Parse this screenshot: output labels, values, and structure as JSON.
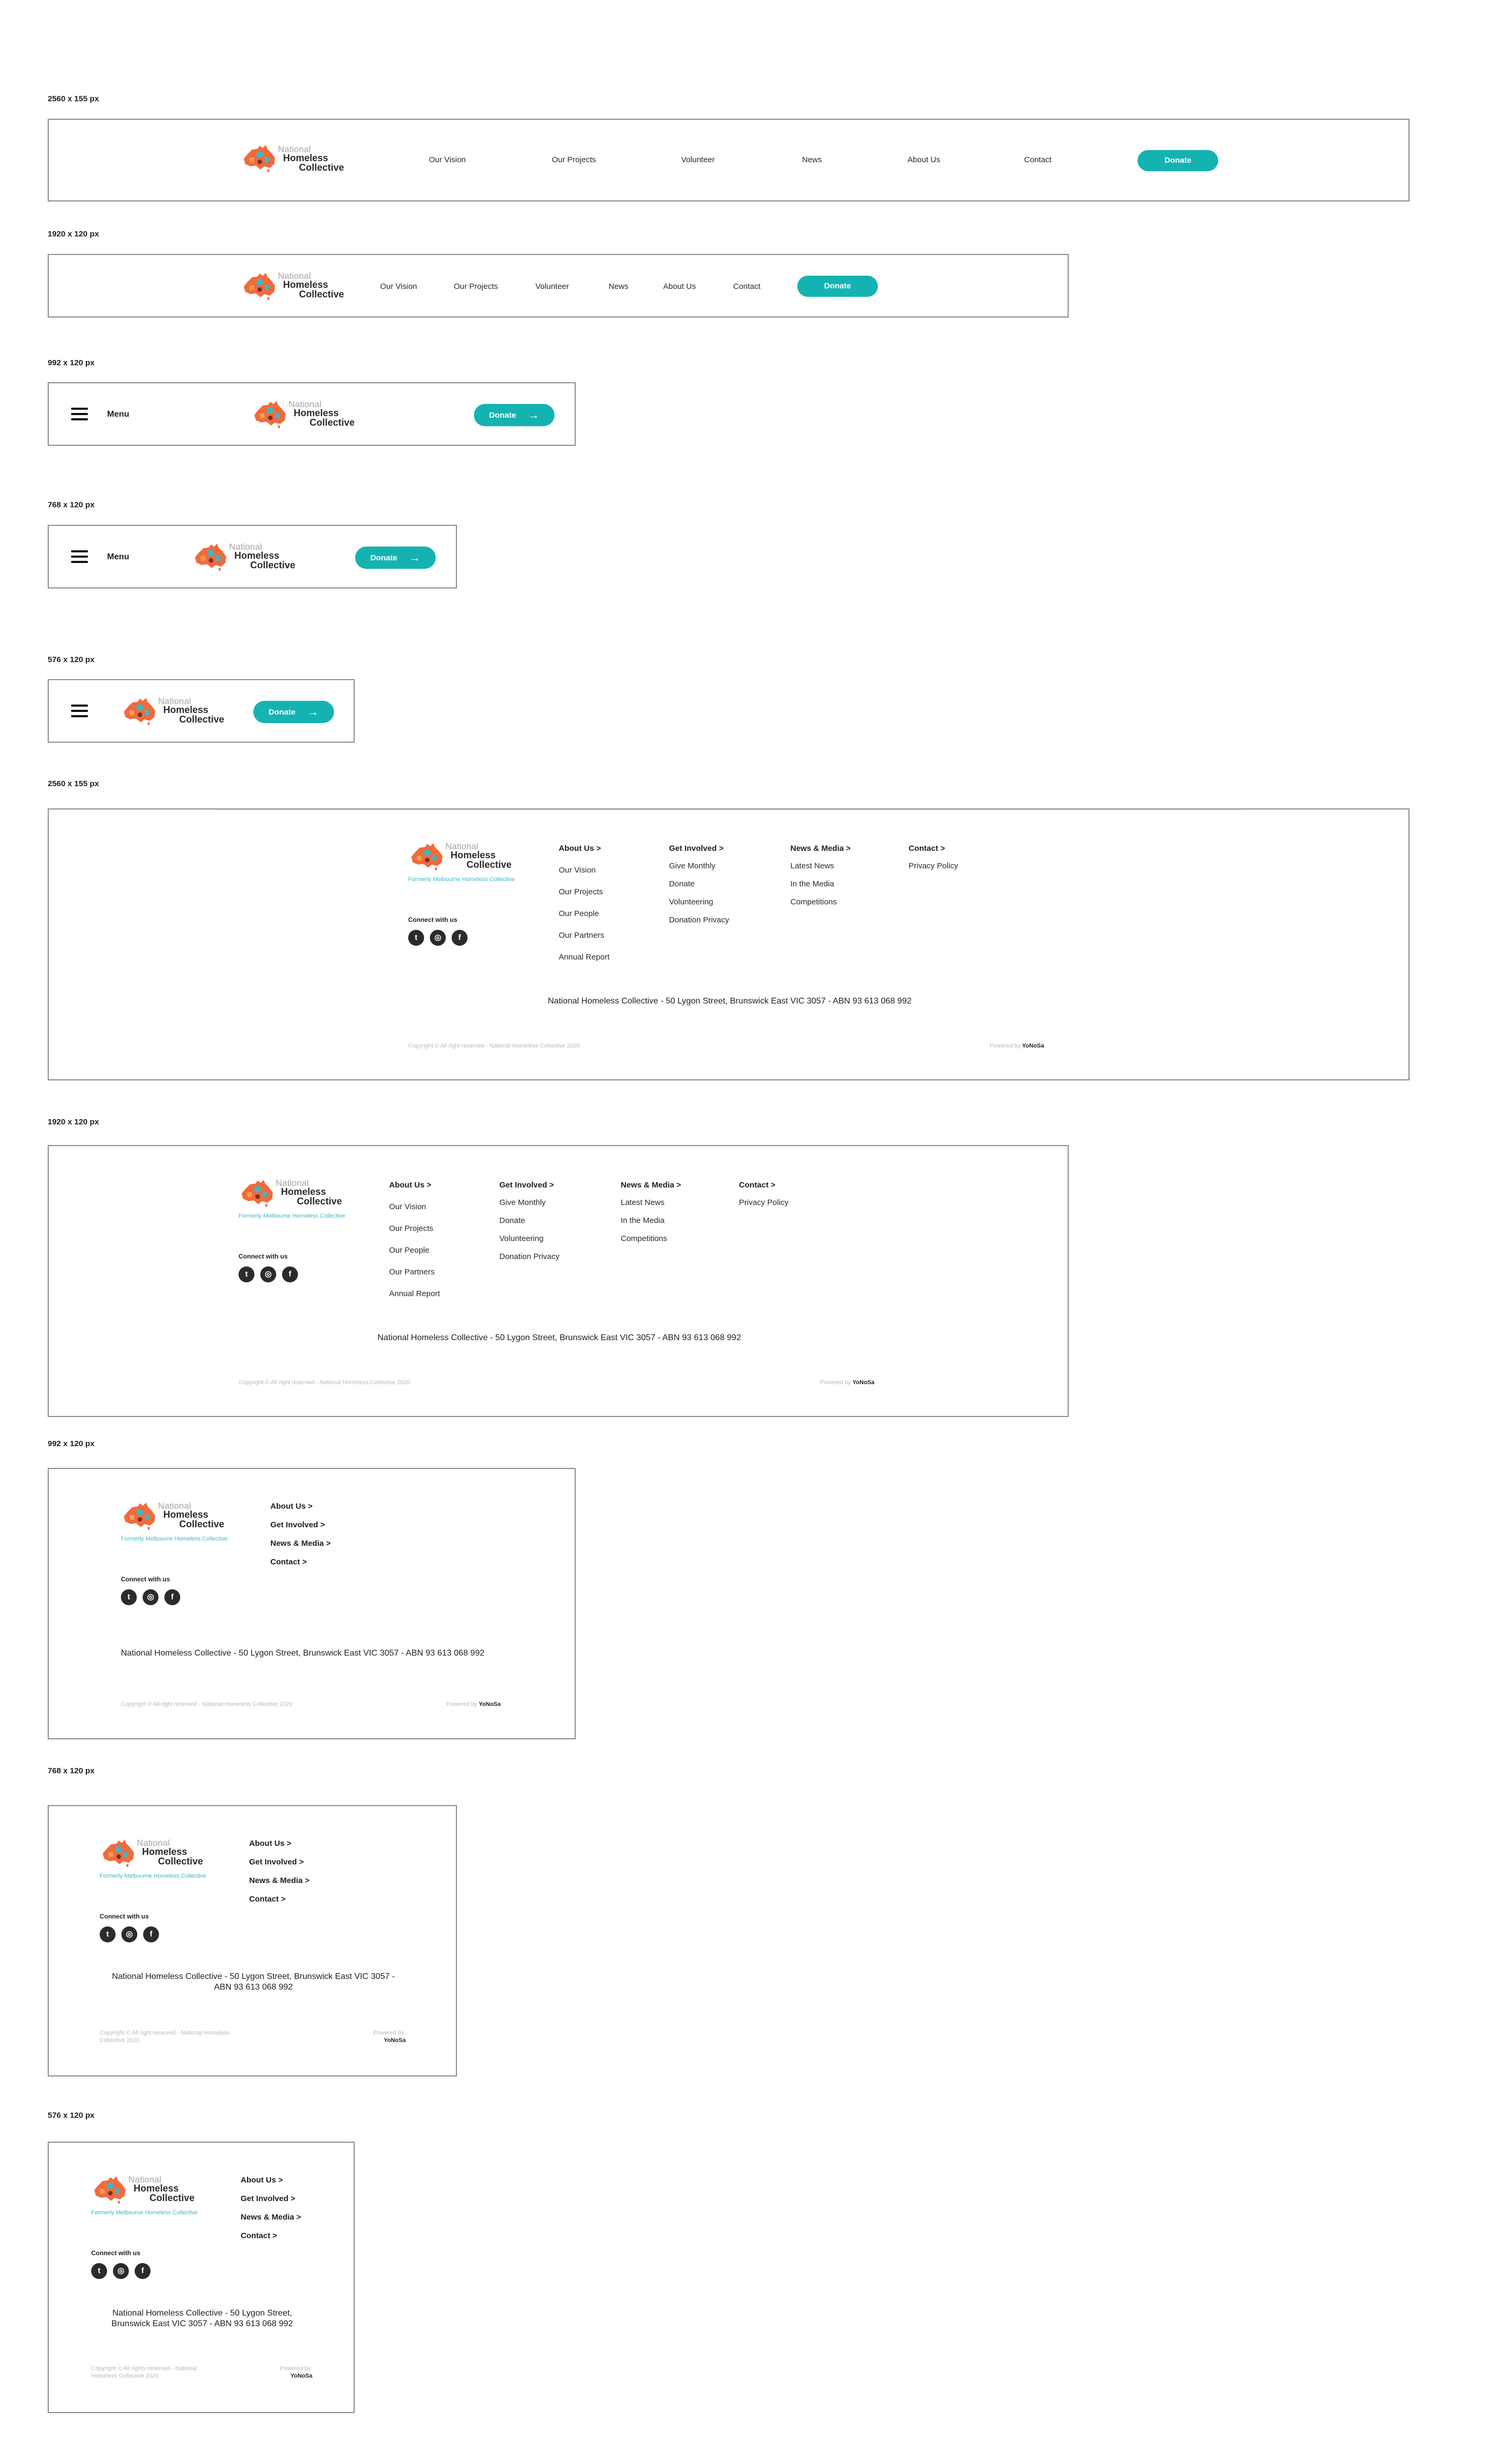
{
  "labels": {
    "h2560": "2560 x 155 px",
    "h1920": "1920 x 120 px",
    "h992": "992 x 120 px",
    "h768": "768 x 120 px",
    "h576": "576 x 120 px",
    "f2560": "2560 x 155 px",
    "f1920": "1920 x 120 px",
    "f992": "992 x 120 px",
    "f768": "768 x 120 px",
    "f576": "576 x 120 px"
  },
  "brand": {
    "line1": "National",
    "line2": "Homeless",
    "line3": "Collective",
    "tagline": "Formerly Melbourne Homeless Collective"
  },
  "nav": {
    "vision": "Our Vision",
    "projects": "Our Projects",
    "volunteer": "Volunteer",
    "news": "News",
    "about": "About Us",
    "contact": "Contact",
    "donate": "Donate",
    "menu": "Menu",
    "arrow": "→"
  },
  "footer": {
    "about_head": "About Us >",
    "about_links": [
      "Our Vision",
      "Our Projects",
      "Our People",
      "Our Partners",
      "Annual Report"
    ],
    "involved_head": "Get Involved >",
    "involved_links": [
      "Give Monthly",
      "Donate",
      "Volunteering",
      "Donation Privacy"
    ],
    "news_head": "News & Media >",
    "news_links": [
      "Latest News",
      "In the Media",
      "Competitions"
    ],
    "contact_head": "Contact >",
    "contact_links": [
      "Privacy Policy"
    ],
    "connect": "Connect with us",
    "address": "National Homeless Collective - 50 Lygon Street, Brunswick East VIC 3057 - ABN 93 613 068 992",
    "address_768_a": "National Homeless Collective - 50 Lygon Street, Brunswick East VIC 3057 -",
    "address_768_b": "ABN 93 613 068 992",
    "address_576_a": "National Homeless Collective - 50 Lygon Street,",
    "address_576_b": "Brunswick East VIC 3057 - ABN 93 613 068 992",
    "copyright": "Copyright © All right reserved - National Homeless Collective 2020",
    "copyright_a": "Copyright © All right reserved - National Homeless",
    "copyright_b": "Collective 2020",
    "copyright_576_a": "Copyright © All rights reserved - National",
    "copyright_576_b": "Homeless Collective 2020",
    "powered_label": "Powered by",
    "powered_brand": "YoNoSa"
  },
  "colors": {
    "accent": "#14b3b2",
    "map_orange": "#f26a3d",
    "map_teal": "#3eb8c3",
    "frame": "#8c8c8c"
  },
  "icons": [
    "hamburger-icon",
    "arrow-right-icon",
    "twitter-icon",
    "instagram-icon",
    "facebook-icon",
    "australia-map-logo-icon"
  ]
}
